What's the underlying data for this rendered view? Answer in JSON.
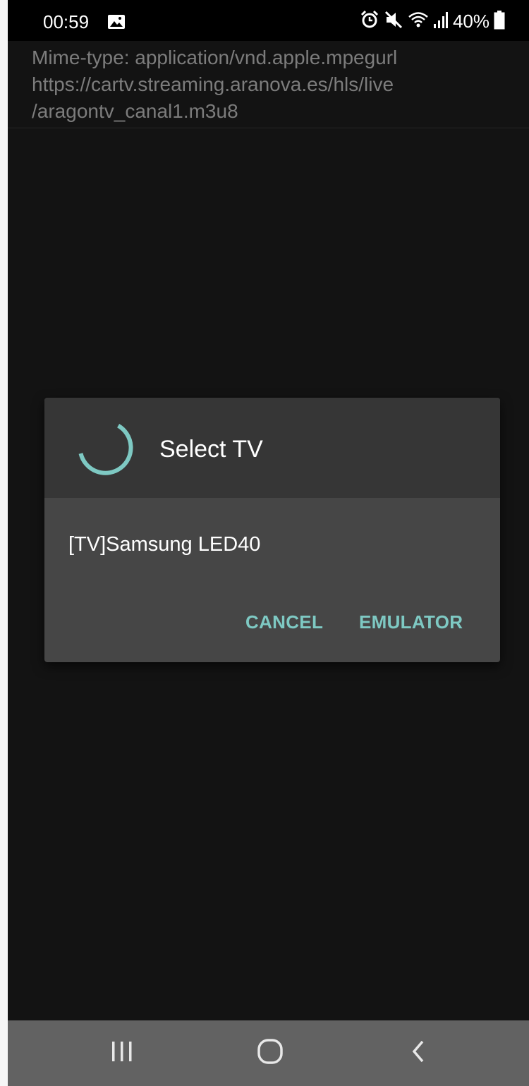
{
  "status_bar": {
    "time": "00:59",
    "battery": "40%",
    "icons": [
      "gallery-icon",
      "alarm-icon",
      "mute-icon",
      "wifi-icon",
      "signal-icon",
      "battery-icon"
    ]
  },
  "media_info": {
    "mime_line": "Mime-type: application/vnd.apple.mpegurl",
    "url_line_1": "https://cartv.streaming.aranova.es/hls/live",
    "url_line_2": "/aragontv_canal1.m3u8"
  },
  "dialog": {
    "title": "Select TV",
    "devices": [
      {
        "label": "[TV]Samsung LED40"
      }
    ],
    "cancel_label": "CANCEL",
    "emulator_label": "EMULATOR"
  },
  "nav_bar": {
    "icons": [
      "recents-icon",
      "home-icon",
      "back-icon"
    ]
  },
  "colors": {
    "accent": "#7ec9c3",
    "background": "#131313",
    "dialog": "#464646",
    "dialog_header": "#363636",
    "nav_bar": "#626262"
  }
}
